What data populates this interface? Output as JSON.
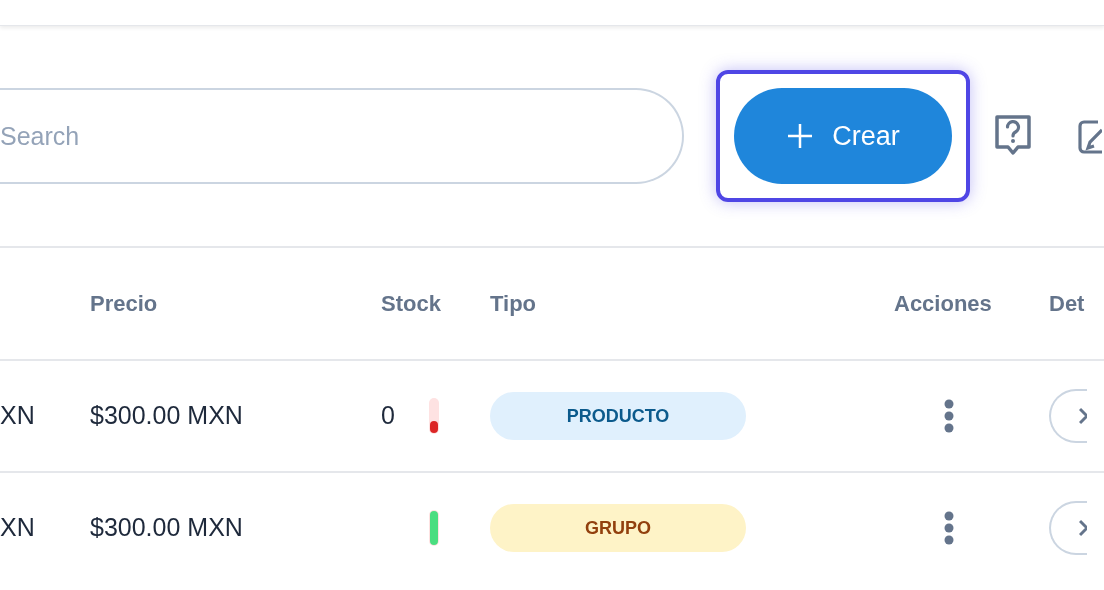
{
  "toolbar": {
    "search": {
      "placeholder": "Search"
    },
    "create_button": {
      "label": "Crear",
      "focused": true
    }
  },
  "table": {
    "columns": [
      "",
      "Precio",
      "Stock",
      "Tipo",
      "Acciones",
      "Det"
    ],
    "rows": [
      {
        "column_1": "XN",
        "precio": "$300.00 MXN",
        "stock": {
          "text": "0",
          "level": 0.35,
          "color": "#dc2626"
        },
        "tipo": {
          "label": "PRODUCTO",
          "kind": "producto"
        }
      },
      {
        "column_1": "XN",
        "precio": "$300.00 MXN",
        "stock": {
          "level": 1,
          "color": "#4ade80"
        },
        "tipo": {
          "label": "GRUPO",
          "kind": "grupo"
        }
      }
    ]
  }
}
